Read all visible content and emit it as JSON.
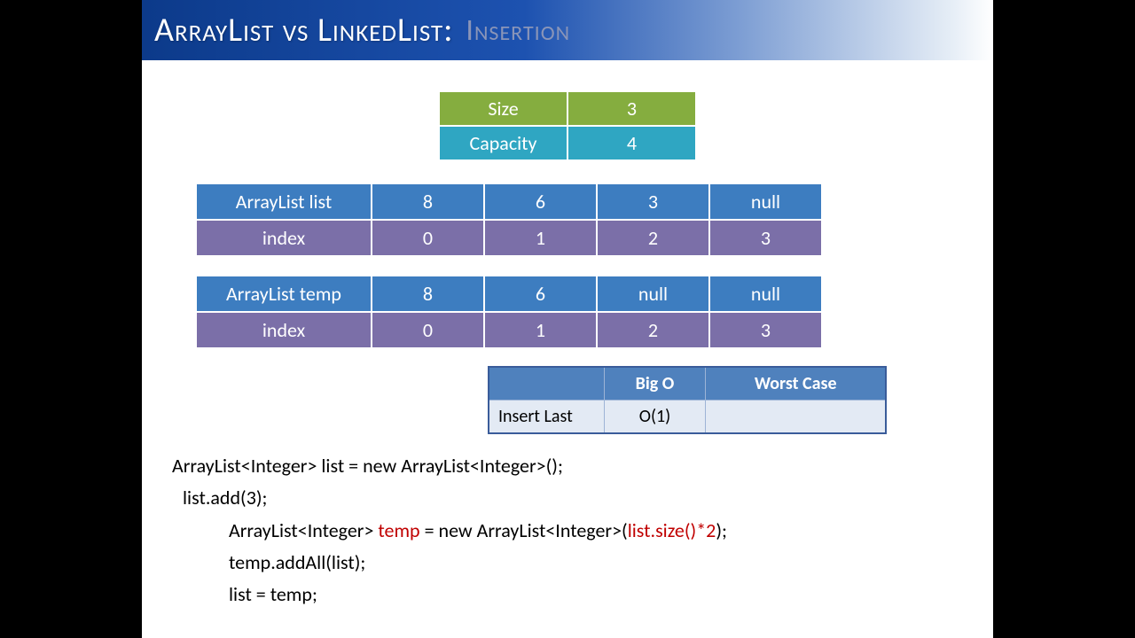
{
  "title": {
    "main": "ArrayList vs LinkedList:",
    "sub": "Insertion"
  },
  "sc": {
    "size_label": "Size",
    "size_val": "3",
    "cap_label": "Capacity",
    "cap_val": "4"
  },
  "arr1": {
    "label": "ArrayList  list",
    "vals": [
      "8",
      "6",
      "3",
      "null"
    ],
    "idx_label": "index",
    "idx": [
      "0",
      "1",
      "2",
      "3"
    ]
  },
  "arr2": {
    "label": "ArrayList  temp",
    "vals": [
      "8",
      "6",
      "null",
      "null"
    ],
    "idx_label": "index",
    "idx": [
      "0",
      "1",
      "2",
      "3"
    ]
  },
  "bigo": {
    "h1": "",
    "h2": "Big O",
    "h3": "Worst Case",
    "r1c1": "Insert Last",
    "r1c2": "O(1)",
    "r1c3": ""
  },
  "code": {
    "l1": "ArrayList<Integer> list = new ArrayList<Integer>();",
    "l2": "list.add(3);",
    "l3a": "ArrayList<Integer> ",
    "l3b": "temp",
    "l3c": " = new ArrayList<Integer>(",
    "l3d": "list.size()*2",
    "l3e": ");",
    "l4": "temp.addAll(list);",
    "l5": "list = temp;"
  }
}
